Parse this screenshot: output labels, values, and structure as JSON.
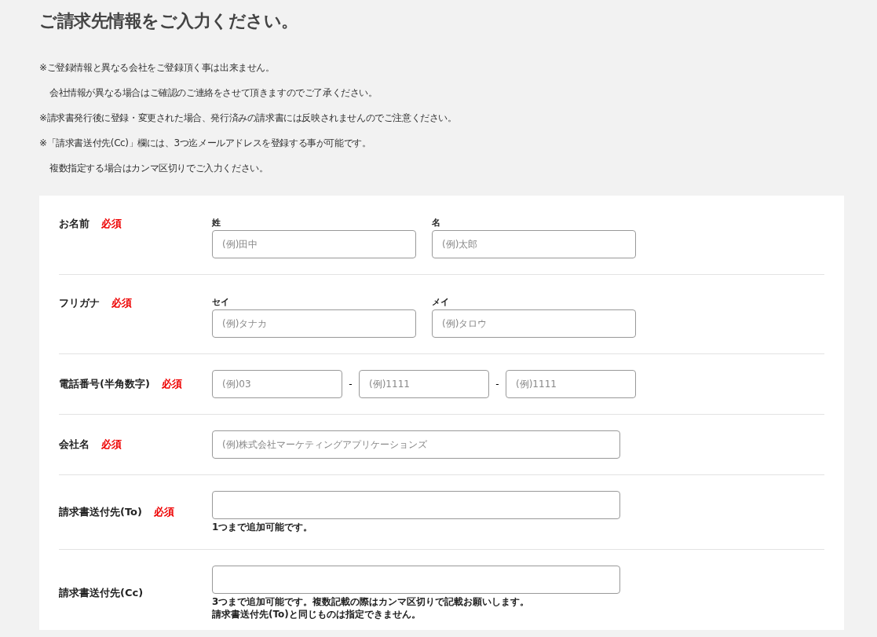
{
  "title": "ご請求先情報をご入力ください。",
  "notes": [
    {
      "text": "※ご登録情報と異なる会社をご登録頂く事は出来ません。",
      "indent": false
    },
    {
      "text": "会社情報が異なる場合はご確認のご連絡をさせて頂きますのでご了承ください。",
      "indent": true
    },
    {
      "text": "※請求書発行後に登録・変更された場合、発行済みの請求書には反映されませんのでご注意ください。",
      "indent": false
    },
    {
      "text": "※「請求書送付先(Cc)」欄には、3つ迄メールアドレスを登録する事が可能です。",
      "indent": false
    },
    {
      "text": "複数指定する場合はカンマ区切りでご入力ください。",
      "indent": true
    }
  ],
  "form_rows": [
    {
      "kind": "split",
      "label": "お名前",
      "badge": "必須",
      "fields": [
        {
          "label": "姓",
          "placeholder": "(例)田中"
        },
        {
          "label": "名",
          "placeholder": "(例)太郎"
        }
      ]
    },
    {
      "kind": "split",
      "label": "フリガナ",
      "badge": "必須",
      "fields": [
        {
          "label": "セイ",
          "placeholder": "(例)タナカ"
        },
        {
          "label": "メイ",
          "placeholder": "(例)タロウ"
        }
      ]
    },
    {
      "kind": "phone",
      "label": "電話番号(半角数字)",
      "badge": "必須",
      "fields": [
        {
          "placeholder": "(例)03"
        },
        {
          "separator": "-",
          "placeholder": "(例)1111"
        },
        {
          "separator": "-",
          "placeholder": "(例)1111"
        }
      ]
    },
    {
      "kind": "single",
      "label": "会社名",
      "badge": "必須",
      "fields": [
        {
          "placeholder": "(例)株式会社マーケティングアプリケーションズ"
        }
      ]
    },
    {
      "kind": "single",
      "label": "請求書送付先(To)",
      "badge": "必須",
      "help": [
        "1つまで追加可能です。"
      ]
    },
    {
      "kind": "single",
      "label": "請求書送付先(Cc)",
      "help": [
        "3つまで追加可能です。複数記載の際はカンマ区切りで記載お願いします。",
        "請求書送付先(To)と同じものは指定できません。"
      ]
    }
  ]
}
